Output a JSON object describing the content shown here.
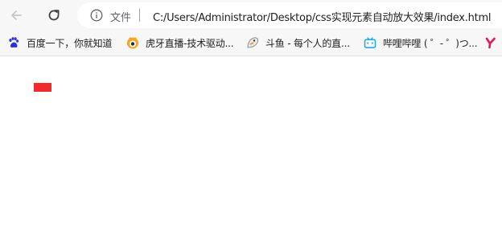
{
  "toolbar": {
    "back_icon": "back-arrow-icon",
    "reload_icon": "reload-icon",
    "info_icon": "info-icon",
    "scheme_label": "文件",
    "url": "C:/Users/Administrator/Desktop/css实现元素自动放大效果/index.html"
  },
  "bookmarks": [
    {
      "label": "百度一下，你就知道",
      "icon": "baidu-paw-icon"
    },
    {
      "label": "虎牙直播-技术驱动...",
      "icon": "huya-icon"
    },
    {
      "label": "斗鱼 - 每个人的直...",
      "icon": "douyu-icon"
    },
    {
      "label": "哔哩哔哩 ( ゜- ゜)つ...",
      "icon": "bilibili-tv-icon"
    },
    {
      "label": "",
      "icon": "youku-y-icon"
    }
  ],
  "page": {
    "box_color": "#f02b2b"
  },
  "colors": {
    "toolbar_bg": "#f7f7f7",
    "baidu_blue": "#2932e1",
    "huya_orange": "#f5a623",
    "bilibili_blue": "#23ade5",
    "youku_red": "#e8175d"
  }
}
